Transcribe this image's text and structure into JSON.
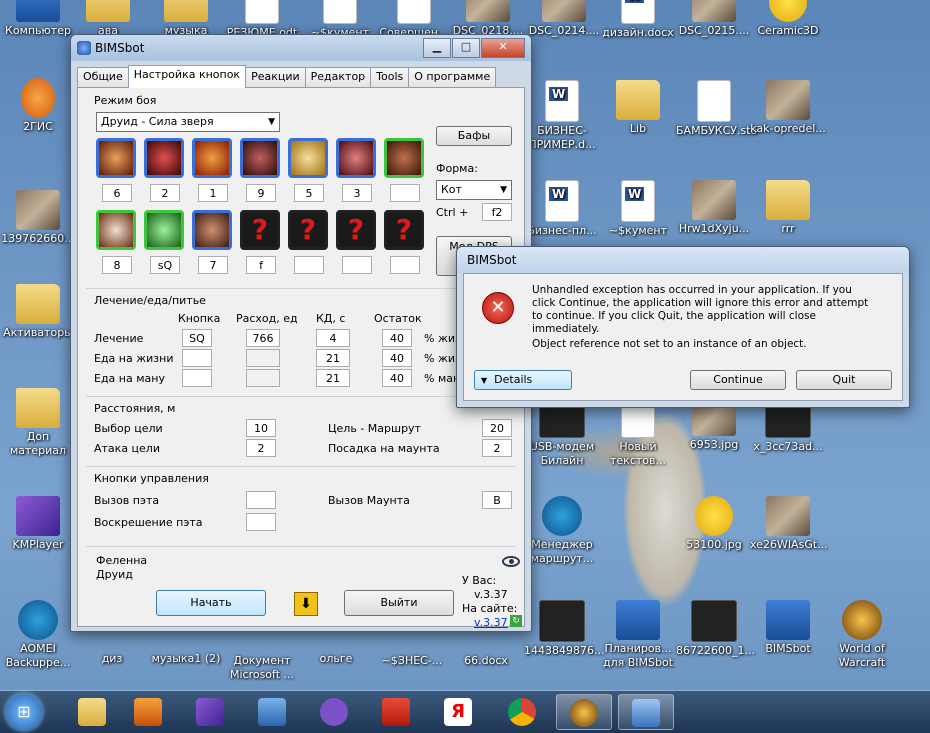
{
  "desktop": {
    "icons": [
      {
        "label": "Компьютер"
      },
      {
        "label": "ава"
      },
      {
        "label": "музыка"
      },
      {
        "label": "РЕЗЮМЕ.odt"
      },
      {
        "label": "~$кумент"
      },
      {
        "label": "Совершен..."
      },
      {
        "label": "DSC_0218...."
      },
      {
        "label": "DSC_0214...."
      },
      {
        "label": "дизайн.docx"
      },
      {
        "label": "DSC_0215...."
      },
      {
        "label": "Ceramic3D"
      },
      {
        "label": "2ГИС"
      },
      {
        "label": "139762660..."
      },
      {
        "label": "Активаторы"
      },
      {
        "label": "Доп материал"
      },
      {
        "label": "KMPlayer"
      },
      {
        "label": "AOMEI Backuppe..."
      },
      {
        "label": "БИЗНЕС-ПРИМЕР.d..."
      },
      {
        "label": "Lib"
      },
      {
        "label": "БАМБУКСУ.sto"
      },
      {
        "label": "kak-opredel..."
      },
      {
        "label": "Бизнес-пл..."
      },
      {
        "label": "~$кумент"
      },
      {
        "label": "Hrw1dXyju..."
      },
      {
        "label": "rrr"
      },
      {
        "label": "USB-модем Билайн"
      },
      {
        "label": "Новый текстов..."
      },
      {
        "label": "6953.jpg"
      },
      {
        "label": "x_3cc73ad..."
      },
      {
        "label": "Менеджер маршрут..."
      },
      {
        "label": "53100.jpg"
      },
      {
        "label": "xe26WIAsGt..."
      },
      {
        "label": "диз"
      },
      {
        "label": "музыка1 (2)"
      },
      {
        "label": "Документ Microsoft ..."
      },
      {
        "label": "ольге"
      },
      {
        "label": "~$ЗНЕС-..."
      },
      {
        "label": "66.docx"
      },
      {
        "label": "1443849876..."
      },
      {
        "label": "Планиров... для BIMSbot"
      },
      {
        "label": "86722600_1..."
      },
      {
        "label": "BIMSbot"
      },
      {
        "label": "World of Warcraft"
      }
    ]
  },
  "main_window": {
    "title": "BIMSbot",
    "tabs": [
      {
        "label": "Общие"
      },
      {
        "label": "Настройка кнопок"
      },
      {
        "label": "Реакции"
      },
      {
        "label": "Редактор"
      },
      {
        "label": "Tools"
      },
      {
        "label": "О программе"
      }
    ],
    "combat": {
      "group_label": "Режим боя",
      "mode_value": "Друид - Сила зверя",
      "buffs_button": "Бафы",
      "form_label": "Форма:",
      "form_value": "Кот",
      "ctrl_label": "Ctrl +",
      "ctrl_value": "f2",
      "row1_keys": [
        "6",
        "2",
        "1",
        "9",
        "5",
        "3",
        ""
      ],
      "row2_keys": [
        "8",
        "sQ",
        "7",
        "f",
        "",
        "",
        ""
      ],
      "big_button": "Мод DPS"
    },
    "heal": {
      "group_label": "Лечение/еда/питье",
      "col_key": "Кнопка",
      "col_cost": "Расход, ед",
      "col_cd": "КД, с",
      "col_rest": "Остаток",
      "rows": [
        {
          "label": "Лечение",
          "key": "SQ",
          "cost": "766",
          "cd": "4",
          "rest": "40",
          "unit": "% жизни"
        },
        {
          "label": "Еда на жизни",
          "key": "",
          "cost": "",
          "cd": "21",
          "rest": "40",
          "unit": "% жизни"
        },
        {
          "label": "Еда на ману",
          "key": "",
          "cost": "",
          "cd": "21",
          "rest": "40",
          "unit": "% маны"
        }
      ]
    },
    "distance": {
      "group_label": "Расстояния, м",
      "target_label": "Выбор цели",
      "target_value": "10",
      "attack_label": "Атака цели",
      "attack_value": "2",
      "route_label": "Цель - Маршрут",
      "route_value": "20",
      "mount_label": "Посадка на маунта",
      "mount_value": "2"
    },
    "controls": {
      "group_label": "Кнопки управления",
      "pet_call_label": "Вызов пэта",
      "pet_call_value": "",
      "pet_revive_label": "Воскрешение пэта",
      "pet_revive_value": "",
      "mount_call_label": "Вызов Маунта",
      "mount_call_value": "B"
    },
    "footer": {
      "char_name": "Феленна",
      "char_class": "Друид",
      "start_button": "Начать",
      "exit_button": "Выйти",
      "you_have_label": "У Вас:",
      "you_have_version": "v.3.37",
      "site_label": "На сайте:",
      "site_version": "v.3.37"
    }
  },
  "error_dialog": {
    "title": "BIMSbot",
    "message": "Unhandled exception has occurred in your application. If you click Continue, the application will ignore this error and attempt to continue. If you click Quit, the application will close immediately.",
    "detail": "Object reference not set to an instance of an object.",
    "details_button": "Details",
    "continue_button": "Continue",
    "quit_button": "Quit"
  },
  "colors": {
    "skill_blue_border": "#3b6fd6",
    "skill_green_border": "#3ec43e",
    "error_red": "#c41a0a"
  }
}
